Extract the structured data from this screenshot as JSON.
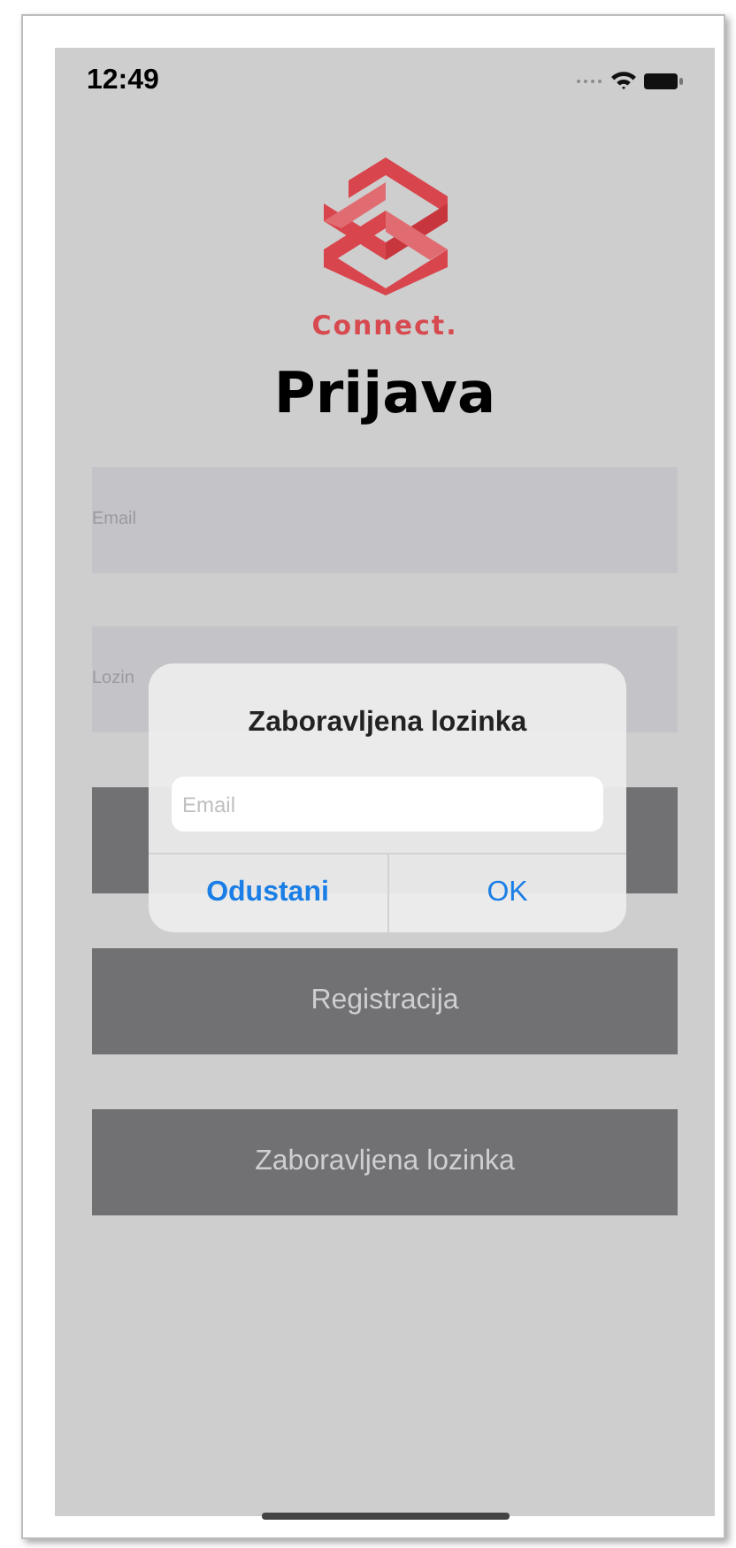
{
  "status_bar": {
    "time": "12:49"
  },
  "logo": {
    "text": "Connect."
  },
  "title": "Prijava",
  "fields": [
    {
      "placeholder": "Email"
    },
    {
      "placeholder": "Lozin"
    }
  ],
  "buttons": [
    {
      "label": "Registracija"
    },
    {
      "label": "Zaboravljena lozinka"
    }
  ],
  "dialog": {
    "title": "Zaboravljena lozinka",
    "field": {
      "placeholder": "Email"
    },
    "actions": [
      {
        "label": "Odustani",
        "kind": "cancel"
      },
      {
        "label": "OK",
        "kind": "default"
      }
    ]
  }
}
